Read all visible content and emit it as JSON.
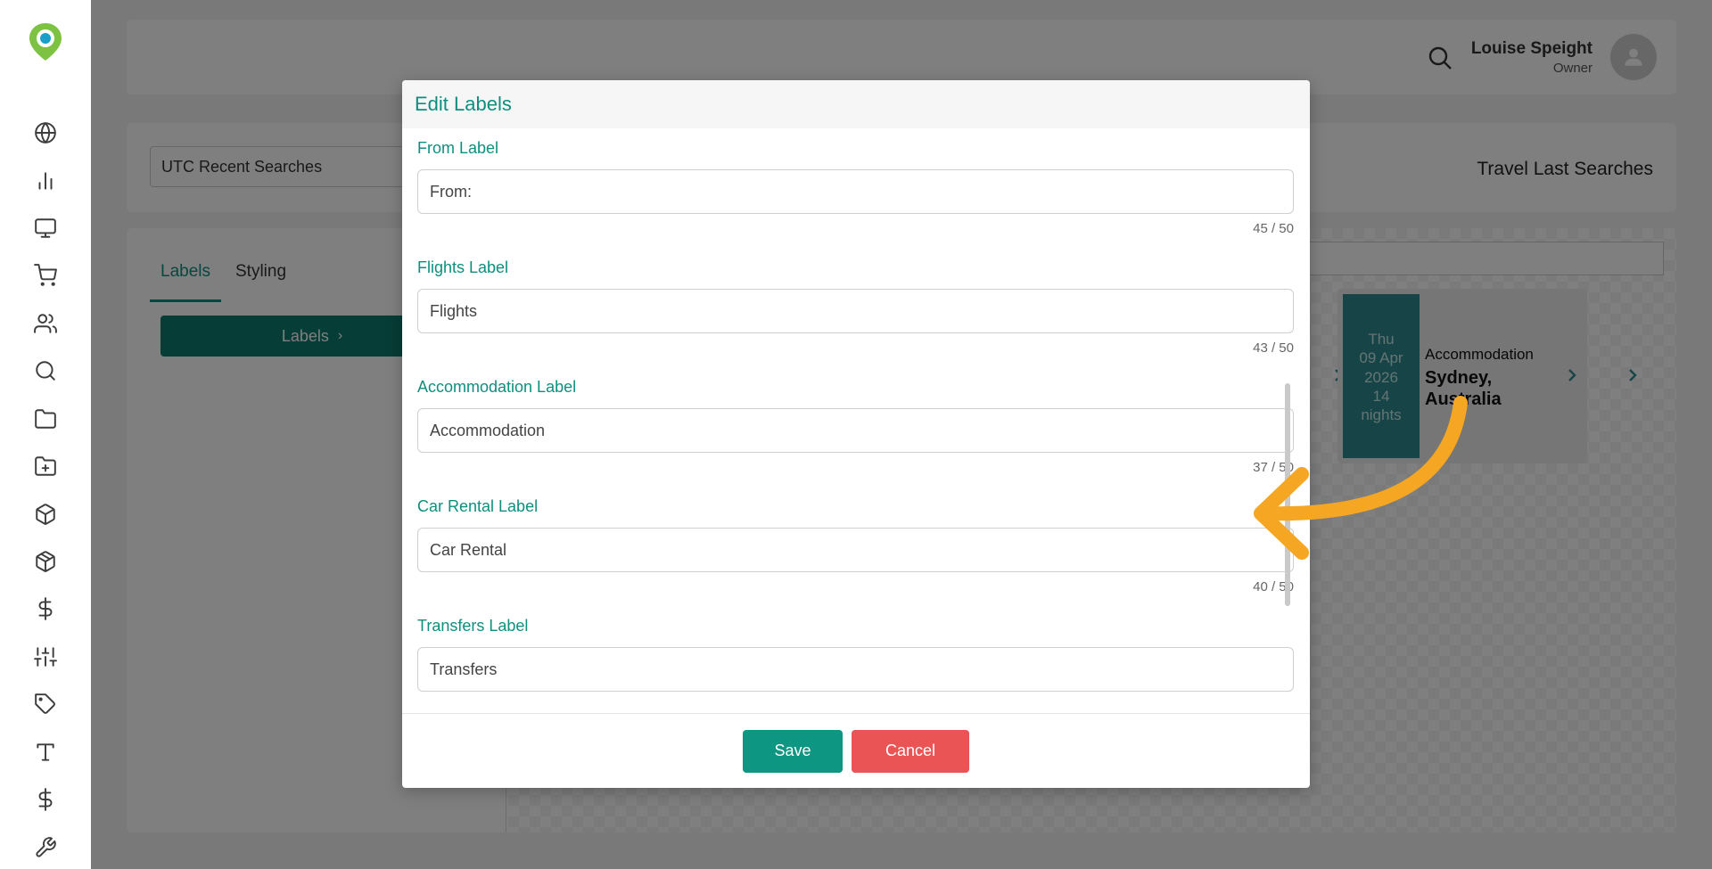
{
  "header": {
    "user_name": "Louise Speight",
    "user_role": "Owner"
  },
  "toolbar": {
    "select_value": "UTC Recent Searches",
    "widget_title": "Travel Last Searches"
  },
  "panel": {
    "tabs": [
      {
        "label": "Labels",
        "active": true
      },
      {
        "label": "Styling",
        "active": false
      }
    ],
    "labels_button": "Labels"
  },
  "preview": {
    "date_lines": [
      "Thu",
      "09 Apr",
      "2026",
      "14",
      "nights"
    ],
    "trip_type": "Accommodation",
    "destination": "Sydney, Australia"
  },
  "modal": {
    "title": "Edit Labels",
    "fields": [
      {
        "label": "From Label",
        "value": "From:",
        "count": "45 / 50"
      },
      {
        "label": "Flights Label",
        "value": "Flights",
        "count": "43 / 50"
      },
      {
        "label": "Accommodation Label",
        "value": "Accommodation",
        "count": "37 / 50"
      },
      {
        "label": "Car Rental Label",
        "value": "Car Rental",
        "count": "40 / 50"
      },
      {
        "label": "Transfers Label",
        "value": "Transfers",
        "count": ""
      }
    ],
    "save_label": "Save",
    "cancel_label": "Cancel"
  },
  "colors": {
    "accent": "#0e8f7e",
    "save": "#0d9682",
    "cancel": "#ea5455",
    "arrow": "#f5a623"
  },
  "sidebar": {
    "icons": [
      "globe-icon",
      "bar-chart-icon",
      "monitor-icon",
      "cart-icon",
      "users-icon",
      "search-icon",
      "folder-icon",
      "folder-plus-icon",
      "box-icon",
      "package-icon",
      "dollar-icon",
      "sliders-icon",
      "tag-icon",
      "type-icon",
      "dollar-icon",
      "wrench-icon"
    ]
  }
}
